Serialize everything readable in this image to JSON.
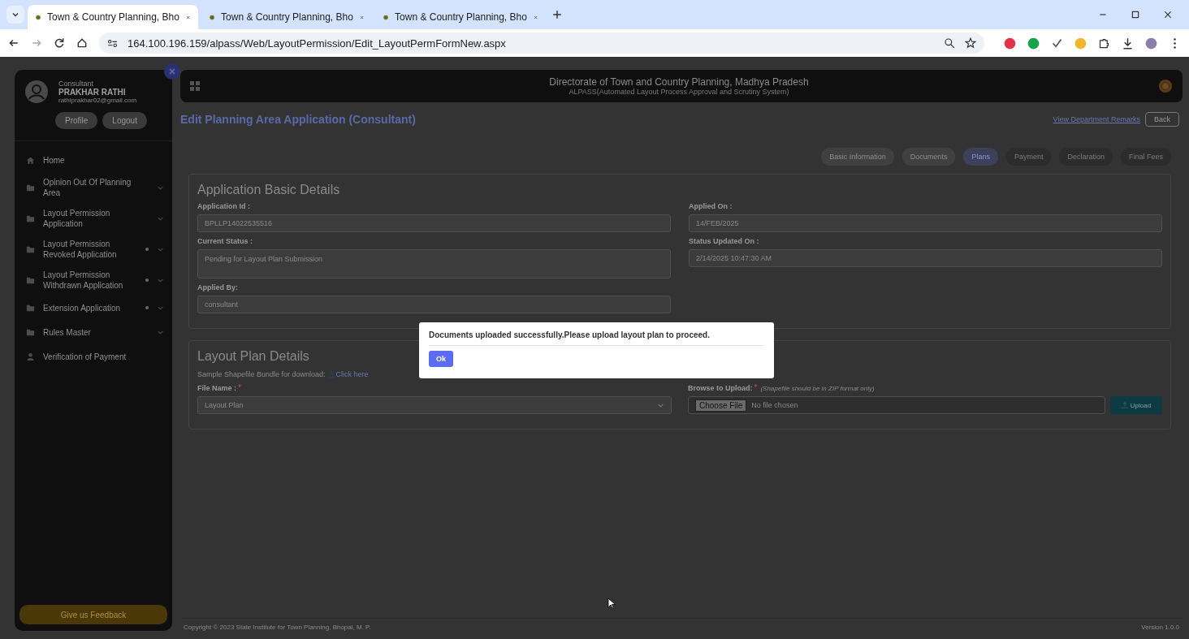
{
  "browser": {
    "tabs": [
      {
        "title": "Town & Country Planning, Bho",
        "selected": true
      },
      {
        "title": "Town & Country Planning, Bho",
        "selected": false
      },
      {
        "title": "Town & Country Planning, Bho",
        "selected": false
      }
    ],
    "url": "164.100.196.159/alpass/Web/LayoutPermission/Edit_LayoutPermFormNew.aspx"
  },
  "sidebar": {
    "role": "Consultant",
    "name": "PRAKHAR RATHI",
    "email": "rathiprakhar02@gmail.com",
    "buttons": [
      "Profile",
      "Logout"
    ],
    "items": [
      {
        "label": "Home",
        "kind": "home",
        "expandable": false,
        "dot": false
      },
      {
        "label": "Opinion Out Of Planning Area",
        "kind": "folder",
        "expandable": true,
        "dot": false
      },
      {
        "label": "Layout Permission Application",
        "kind": "folder",
        "expandable": true,
        "dot": false
      },
      {
        "label": "Layout Permission Revoked Application",
        "kind": "folder",
        "expandable": true,
        "dot": true
      },
      {
        "label": "Layout Permission Withdrawn Application",
        "kind": "folder",
        "expandable": true,
        "dot": true
      },
      {
        "label": "Extension Application",
        "kind": "folder",
        "expandable": true,
        "dot": true
      },
      {
        "label": "Rules Master",
        "kind": "folder",
        "expandable": true,
        "dot": false
      },
      {
        "label": "Verification of Payment",
        "kind": "user",
        "expandable": false,
        "dot": false
      }
    ],
    "feedback": "Give us Feedback"
  },
  "header": {
    "title": "Directorate of Town and Country Planning, Madhya Pradesh",
    "subtitle": "ALPASS(Automated Layout Process Approval and Scrutiny System)"
  },
  "page": {
    "title": "Edit Planning Area Application (Consultant)",
    "remarks_link": "View Department Remarks",
    "back": "Back"
  },
  "steps": [
    {
      "label": "Basic Information",
      "selected": false,
      "disabled": false
    },
    {
      "label": "Documents",
      "selected": false,
      "disabled": false
    },
    {
      "label": "Plans",
      "selected": true,
      "disabled": false
    },
    {
      "label": "Payment",
      "selected": false,
      "disabled": true
    },
    {
      "label": "Declaration",
      "selected": false,
      "disabled": true
    },
    {
      "label": "Final Fees",
      "selected": false,
      "disabled": true
    }
  ],
  "basic": {
    "title": "Application Basic Details",
    "fields": [
      {
        "label": "Application Id :",
        "value": "BPLLP14022535516",
        "tall": false
      },
      {
        "label": "Applied On :",
        "value": "14/FEB/2025",
        "tall": false
      },
      {
        "label": "Current Status :",
        "value": "Pending for Layout Plan Submission",
        "tall": true
      },
      {
        "label": "Status Updated On :",
        "value": "2/14/2025 10:47:30 AM",
        "tall": false
      },
      {
        "label": "Applied By:",
        "value": "consultant",
        "tall": false
      }
    ]
  },
  "plan": {
    "title": "Layout Plan Details",
    "sample_text": "Sample Shapefile Bundle for download:",
    "sample_link": "Click here",
    "file_label": "File Name :",
    "file_required": "*",
    "upload_required": "*",
    "file_value": "Layout Plan",
    "upload_label": "Browse to Upload:",
    "upload_note": "(Shapefile should be in ZIP format only)",
    "choose": "Choose File",
    "no_file": "No file chosen",
    "upload": "Upload"
  },
  "footer": {
    "copyright": "Copyright © 2023 State Institute for Town Planning, Bhopal, M. P.",
    "version": "Version 1.0.0"
  },
  "dialog": {
    "message": "Documents uploaded successfully.Please upload layout plan to proceed.",
    "ok": "Ok"
  }
}
